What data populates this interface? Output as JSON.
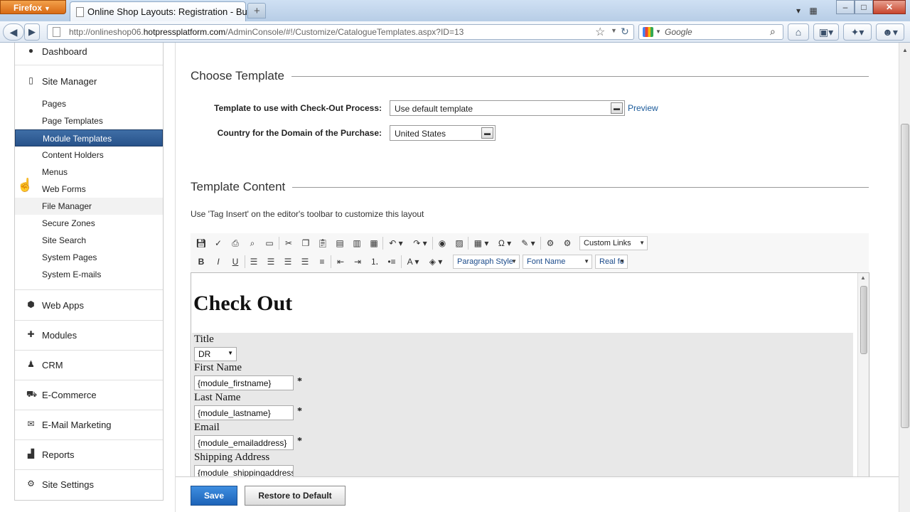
{
  "browser": {
    "app_button": "Firefox",
    "tab_title": "Online Shop Layouts: Registration - Buy",
    "url_prefix": "http://onlineshop06.",
    "url_domain": "hotpressplatform.com",
    "url_path": "/AdminConsole/#!/Customize/CatalogueTemplates.aspx?ID=13",
    "search_placeholder": "Google"
  },
  "sidebar": {
    "sections": [
      {
        "label": "Dashboard",
        "icon": "dashboard-icon"
      },
      {
        "label": "Site Manager",
        "icon": "page-icon"
      },
      {
        "label": "Web Apps",
        "icon": "cube-icon"
      },
      {
        "label": "Modules",
        "icon": "puzzle-icon"
      },
      {
        "label": "CRM",
        "icon": "person-icon"
      },
      {
        "label": "E-Commerce",
        "icon": "cart-icon"
      },
      {
        "label": "E-Mail Marketing",
        "icon": "envelope-icon"
      },
      {
        "label": "Reports",
        "icon": "bar-chart-icon"
      },
      {
        "label": "Site Settings",
        "icon": "gear-icon"
      }
    ],
    "site_manager_items": [
      "Pages",
      "Page Templates",
      "Module Templates",
      "Content Holders",
      "Menus",
      "Web Forms",
      "File Manager",
      "Secure Zones",
      "Site Search",
      "System Pages",
      "System E-mails"
    ],
    "active_item": "Module Templates"
  },
  "choose_template": {
    "legend": "Choose Template",
    "checkout_label": "Template to use with Check-Out Process:",
    "checkout_value": "Use default template",
    "preview_link": "Preview",
    "country_label": "Country for the Domain of the Purchase:",
    "country_value": "United States"
  },
  "template_content": {
    "legend": "Template Content",
    "hint": "Use 'Tag Insert' on the editor's toolbar to customize this layout"
  },
  "toolbar": {
    "custom_links": "Custom Links",
    "paragraph_style": "Paragraph Style",
    "font_name": "Font Name",
    "real_font": "Real fo"
  },
  "editor": {
    "heading": "Check Out",
    "title_label": "Title",
    "title_value": "DR",
    "first_name_label": "First Name",
    "first_name_value": "{module_firstname}",
    "last_name_label": "Last Name",
    "last_name_value": "{module_lastname}",
    "email_label": "Email",
    "email_value": "{module_emailaddress}",
    "shipping_label": "Shipping Address",
    "shipping_value": "{module_shippingaddress}",
    "required_mark": "*"
  },
  "actions": {
    "save": "Save",
    "restore": "Restore to Default"
  }
}
